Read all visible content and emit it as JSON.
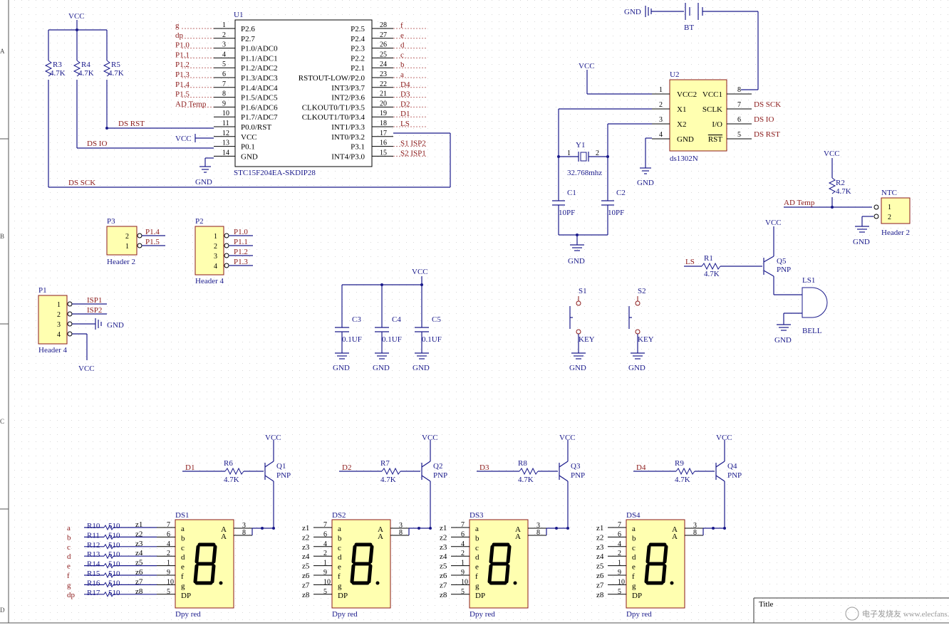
{
  "u1": {
    "ref": "U1",
    "part": "STC15F204EA-SKDIP28",
    "left_pins": [
      {
        "num": "1",
        "name": "P2.6",
        "net": "g"
      },
      {
        "num": "2",
        "name": "P2.7",
        "net": "dp"
      },
      {
        "num": "3",
        "name": "P1.0/ADC0",
        "net": "P1.0"
      },
      {
        "num": "4",
        "name": "P1.1/ADC1",
        "net": "P1.1"
      },
      {
        "num": "5",
        "name": "P1.2/ADC2",
        "net": "P1.2"
      },
      {
        "num": "6",
        "name": "P1.3/ADC3",
        "net": "P1.3"
      },
      {
        "num": "7",
        "name": "P1.4/ADC4",
        "net": "P1.4"
      },
      {
        "num": "8",
        "name": "P1.5/ADC5",
        "net": "P1.5"
      },
      {
        "num": "9",
        "name": "P1.6/ADC6",
        "net": "AD Temp"
      },
      {
        "num": "10",
        "name": "P1.7/ADC7",
        "net": ""
      },
      {
        "num": "11",
        "name": "P0.0/RST",
        "net": ""
      },
      {
        "num": "12",
        "name": "VCC",
        "net": ""
      },
      {
        "num": "13",
        "name": "P0.1",
        "net": ""
      },
      {
        "num": "14",
        "name": "GND",
        "net": ""
      }
    ],
    "right_pins": [
      {
        "num": "28",
        "name": "P2.5",
        "net": "f"
      },
      {
        "num": "27",
        "name": "P2.4",
        "net": "e"
      },
      {
        "num": "26",
        "name": "P2.3",
        "net": "d"
      },
      {
        "num": "25",
        "name": "P2.2",
        "net": "c"
      },
      {
        "num": "24",
        "name": "P2.1",
        "net": "b"
      },
      {
        "num": "23",
        "name": "RSTOUT-LOW/P2.0",
        "net": "a"
      },
      {
        "num": "22",
        "name": "INT3/P3.7",
        "net": "D4"
      },
      {
        "num": "21",
        "name": "INT2/P3.6",
        "net": "D3"
      },
      {
        "num": "20",
        "name": "CLKOUT0/T1/P3.5",
        "net": "D2"
      },
      {
        "num": "19",
        "name": "CLKOUT1/T0/P3.4",
        "net": "D1"
      },
      {
        "num": "18",
        "name": "INT1/P3.3",
        "net": "LS"
      },
      {
        "num": "17",
        "name": "INT0/P3.2",
        "net": ""
      },
      {
        "num": "16",
        "name": "P3.1",
        "net": "S1 ISP2"
      },
      {
        "num": "15",
        "name": "INT4/P3.0",
        "net": "S2 ISP1"
      }
    ]
  },
  "nets": {
    "vcc": "VCC",
    "gnd": "GND",
    "ds_rst": "DS RST",
    "ds_io": "DS IO",
    "ds_sck": "DS SCK",
    "ad_temp": "AD Temp",
    "ls": "LS",
    "d1": "D1",
    "d2": "D2",
    "d3": "D3",
    "d4": "D4"
  },
  "pullups": [
    {
      "ref": "R3",
      "value": "4.7K"
    },
    {
      "ref": "R4",
      "value": "4.7K"
    },
    {
      "ref": "R5",
      "value": "4.7K"
    }
  ],
  "bt": {
    "ref": "BT"
  },
  "u2": {
    "ref": "U2",
    "part": "ds1302N",
    "left_pins": [
      {
        "num": "1",
        "name": "VCC2"
      },
      {
        "num": "2",
        "name": "X1"
      },
      {
        "num": "3",
        "name": "X2"
      },
      {
        "num": "4",
        "name": "GND"
      }
    ],
    "right_pins": [
      {
        "num": "8",
        "name": "VCC1"
      },
      {
        "num": "7",
        "name": "SCLK"
      },
      {
        "num": "6",
        "name": "I/O"
      },
      {
        "num": "5",
        "name": "RST"
      }
    ]
  },
  "crystal": {
    "ref": "Y1",
    "value": "32.768mhz",
    "pin1": "1",
    "pin2": "2"
  },
  "c1": {
    "ref": "C1",
    "value": "10PF"
  },
  "c2": {
    "ref": "C2",
    "value": "10PF"
  },
  "r2": {
    "ref": "R2",
    "value": "4.7K"
  },
  "ntc": {
    "ref": "NTC",
    "part": "Header 2",
    "pins": [
      "1",
      "2"
    ]
  },
  "r1": {
    "ref": "R1",
    "value": "4.7K"
  },
  "q5": {
    "ref": "Q5",
    "type": "PNP"
  },
  "ls1": {
    "ref": "LS1",
    "part": "BELL"
  },
  "p3": {
    "ref": "P3",
    "part": "Header 2",
    "pins": [
      "2",
      "1"
    ],
    "nets": [
      "P1.4",
      "P1.5"
    ]
  },
  "p2": {
    "ref": "P2",
    "part": "Header 4",
    "pins": [
      "1",
      "2",
      "3",
      "4"
    ],
    "nets": [
      "P1.0",
      "P1.1",
      "P1.2",
      "P1.3"
    ]
  },
  "p1": {
    "ref": "P1",
    "part": "Header 4",
    "pins": [
      "1",
      "2",
      "3",
      "4"
    ],
    "nets": [
      "ISP1",
      "ISP2"
    ]
  },
  "decaps": [
    {
      "ref": "C3",
      "value": "0.1UF"
    },
    {
      "ref": "C4",
      "value": "0.1UF"
    },
    {
      "ref": "C5",
      "value": "0.1UF"
    }
  ],
  "switches": [
    {
      "ref": "S1",
      "part": "KEY"
    },
    {
      "ref": "S2",
      "part": "KEY"
    }
  ],
  "digits": [
    {
      "ds": "DS1",
      "r": "R6",
      "rv": "4.7K",
      "q": "Q1",
      "qt": "PNP",
      "net": "D1",
      "part": "Dpy red"
    },
    {
      "ds": "DS2",
      "r": "R7",
      "rv": "4.7K",
      "q": "Q2",
      "qt": "PNP",
      "net": "D2",
      "part": "Dpy red"
    },
    {
      "ds": "DS3",
      "r": "R8",
      "rv": "4.7K",
      "q": "Q3",
      "qt": "PNP",
      "net": "D3",
      "part": "Dpy red"
    },
    {
      "ds": "DS4",
      "r": "R9",
      "rv": "4.7K",
      "q": "Q4",
      "qt": "PNP",
      "net": "D4",
      "part": "Dpy red"
    }
  ],
  "seg_names": [
    "a",
    "b",
    "c",
    "d",
    "e",
    "f",
    "g",
    "DP"
  ],
  "seg_pins": [
    "7",
    "6",
    "4",
    "2",
    "1",
    "9",
    "10",
    "5"
  ],
  "z_nets": [
    "z1",
    "z2",
    "z3",
    "z4",
    "z5",
    "z6",
    "z7",
    "z8"
  ],
  "com_pins": [
    "3",
    "8"
  ],
  "com_names": [
    "A",
    "A"
  ],
  "seg_res": [
    {
      "ref": "R10",
      "value": "510",
      "net": "a"
    },
    {
      "ref": "R11",
      "value": "510",
      "net": "b"
    },
    {
      "ref": "R12",
      "value": "510",
      "net": "c"
    },
    {
      "ref": "R13",
      "value": "510",
      "net": "d"
    },
    {
      "ref": "R14",
      "value": "510",
      "net": "e"
    },
    {
      "ref": "R15",
      "value": "510",
      "net": "f"
    },
    {
      "ref": "R16",
      "value": "510",
      "net": "g"
    },
    {
      "ref": "R17",
      "value": "510",
      "net": "dp"
    }
  ],
  "titleblock": {
    "title": "Title"
  },
  "border_letters": [
    "A",
    "B",
    "C",
    "D"
  ],
  "watermark": "电子发烧友 www.elecfans.com"
}
